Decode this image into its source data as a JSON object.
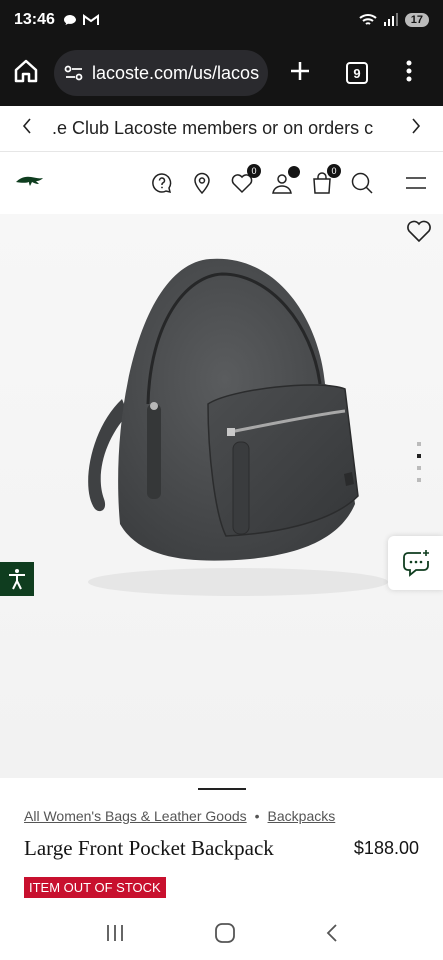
{
  "status_bar": {
    "time": "13:46",
    "battery": "17"
  },
  "browser": {
    "url": "lacoste.com/us/lacos",
    "tab_count": "9"
  },
  "promo": {
    "text": ".e Club Lacoste members or on orders c"
  },
  "header": {
    "help_icon": "question-icon",
    "store_icon": "location-icon",
    "wishlist_count": "0",
    "cart_count": "0"
  },
  "product": {
    "breadcrumb": [
      "All Women's Bags & Leather Goods",
      "Backpacks"
    ],
    "breadcrumb_separator": "•",
    "title": "Large Front Pocket Backpack",
    "price": "$188.00",
    "stock_status": "ITEM OUT OF STOCK",
    "carousel_active_index": 1,
    "carousel_count": 4
  },
  "colors": {
    "brand_green": "#0f3d1f",
    "stock_red": "#c8102e",
    "bag_color": "#4a4c4e"
  }
}
